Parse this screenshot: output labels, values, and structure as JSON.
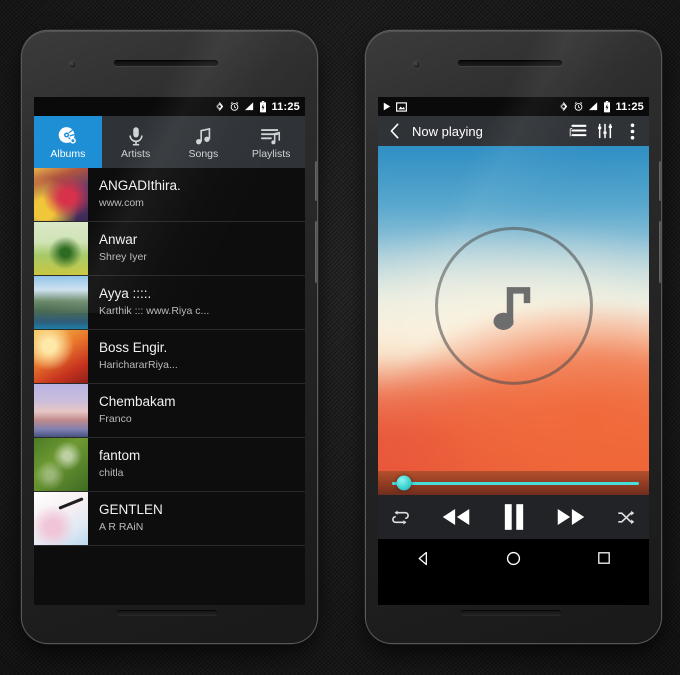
{
  "background": {
    "color": "#1c1c1c"
  },
  "accent": {
    "tab_active": "#1e8fd5",
    "seek": "#46dedb",
    "appbar": "#2f3337"
  },
  "left_phone": {
    "statusbar": {
      "time": "11:25",
      "icons": [
        "brightness-icon",
        "alarm-icon",
        "signal-icon",
        "battery-icon"
      ]
    },
    "tabs": [
      {
        "label": "Albums",
        "icon": "album-disc-icon",
        "active": true
      },
      {
        "label": "Artists",
        "icon": "microphone-icon",
        "active": false
      },
      {
        "label": "Songs",
        "icon": "music-note-icon",
        "active": false
      },
      {
        "label": "Playlists",
        "icon": "playlist-icon",
        "active": false
      }
    ],
    "albums": [
      {
        "title": "ANGADIthira.",
        "artist": "www.com",
        "art": "art0"
      },
      {
        "title": "Anwar",
        "artist": "Shrey Iyer",
        "art": "art1"
      },
      {
        "title": "Ayya ::::.",
        "artist": "Karthik ::: www.Riya c...",
        "art": "art2"
      },
      {
        "title": "Boss Engir.",
        "artist": "HarichararRiya...",
        "art": "art3"
      },
      {
        "title": "Chembakam",
        "artist": "Franco",
        "art": "art4"
      },
      {
        "title": "fantom",
        "artist": "chitla",
        "art": "art5"
      },
      {
        "title": "GENTLEN",
        "artist": "A R RAiN",
        "art": "art6"
      }
    ],
    "navbar": [
      {
        "label": "Back",
        "icon": "back-triangle-icon"
      },
      {
        "label": "Home",
        "icon": "home-circle-icon"
      },
      {
        "label": "Recents",
        "icon": "recents-square-icon"
      }
    ]
  },
  "right_phone": {
    "statusbar": {
      "time": "11:25",
      "left_icons": [
        "play-icon",
        "screenshot-icon"
      ],
      "icons": [
        "brightness-icon",
        "alarm-icon",
        "signal-icon",
        "battery-icon"
      ]
    },
    "appbar": {
      "back_icon": "chevron-left-icon",
      "title": "Now playing",
      "queue_icon": "queue-list-icon",
      "equalizer_icon": "equalizer-icon",
      "overflow_icon": "overflow-menu-icon"
    },
    "artwork": {
      "placeholder_icon": "music-note-icon",
      "circle_icon": "circle-outline-icon"
    },
    "seekbar": {
      "progress_percent": 5
    },
    "controls": [
      {
        "label": "Repeat",
        "icon": "repeat-icon"
      },
      {
        "label": "Previous",
        "icon": "rewind-icon"
      },
      {
        "label": "Pause",
        "icon": "pause-icon"
      },
      {
        "label": "Next",
        "icon": "fast-forward-icon"
      },
      {
        "label": "Shuffle",
        "icon": "shuffle-icon"
      }
    ],
    "navbar": [
      {
        "label": "Back",
        "icon": "back-triangle-icon"
      },
      {
        "label": "Home",
        "icon": "home-circle-icon"
      },
      {
        "label": "Recents",
        "icon": "recents-square-icon"
      }
    ]
  }
}
